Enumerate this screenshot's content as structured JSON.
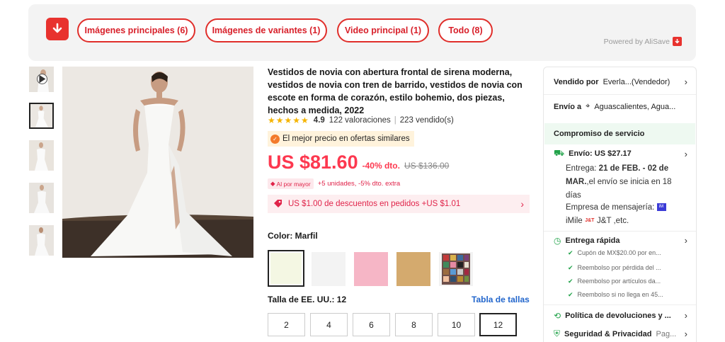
{
  "alisave": {
    "tabs": [
      {
        "label": "Imágenes principales (6)"
      },
      {
        "label": "Imágenes de variantes (1)"
      },
      {
        "label": "Video principal (1)"
      },
      {
        "label": "Todo (8)"
      }
    ],
    "powered_by": "Powered by AliSave",
    "accent": "#e8322e"
  },
  "gallery": {
    "thumbnails": [
      "video-thumbnail",
      "dress-front",
      "dress-side",
      "dress-full",
      "dress-back"
    ],
    "selected_index": 1
  },
  "product": {
    "title": "Vestidos de novia con abertura frontal de sirena moderna, vestidos de novia con tren de barrido, vestidos de novia con escote en forma de corazón, estilo bohemio, dos piezas, hechos a medida, 2022",
    "rating": "4.9",
    "reviews": "122 valoraciones",
    "sold": "223 vendido(s)",
    "best_price": "El mejor precio en ofertas similares",
    "price": "US $81.60",
    "discount": "-40% dto.",
    "old_price": "US $136.00",
    "bulk_tag": "Al por mayor",
    "bulk_text": "+5 unidades, -5% dto. extra",
    "coupon": "US $1.00 de descuentos en pedidos +US $1.01",
    "color_label": "Color: Marfil",
    "swatches": [
      {
        "name": "Marfil",
        "color": "#f4f7e3"
      },
      {
        "name": "Blanco",
        "color": "#f3f3f3"
      },
      {
        "name": "Rosa",
        "color": "#f6b6c6"
      },
      {
        "name": "Champán",
        "color": "#d4aa6e"
      },
      {
        "name": "Carta de colores",
        "color": "#b3565a"
      }
    ],
    "size_label": "Talla de EE. UU.: 12",
    "size_chart": "Tabla de tallas",
    "sizes": [
      "2",
      "4",
      "6",
      "8",
      "10",
      "12"
    ],
    "selected_size": "12",
    "price_color": "#fd384f"
  },
  "panel": {
    "sold_by_label": "Vendido por",
    "sold_by_value": "Everla...(Vendedor)",
    "ship_to_label": "Envío a",
    "ship_to_value": "Aguascalientes, Agua...",
    "service_title": "Compromiso de servicio",
    "shipping_title": "Envío: US $27.17",
    "delivery_prefix": "Entrega: ",
    "delivery_date": "21 de FEB. - 02 de MAR.",
    "delivery_suffix": ",el envío se inicia en 18 días",
    "carrier_label": "Empresa de mensajería:",
    "carriers": [
      "iMile",
      "J&T ,etc."
    ],
    "fast_title": "Entrega rápida",
    "fast_items": [
      "Cupón de MX$20.00 por en...",
      "Reembolso por pérdida del ...",
      "Reembolso por artículos da...",
      "Reembolso si no llega en 45..."
    ],
    "returns": "Política de devoluciones y ...",
    "security_bold": "Seguridad & Privacidad",
    "security_rest": "Pag..."
  }
}
